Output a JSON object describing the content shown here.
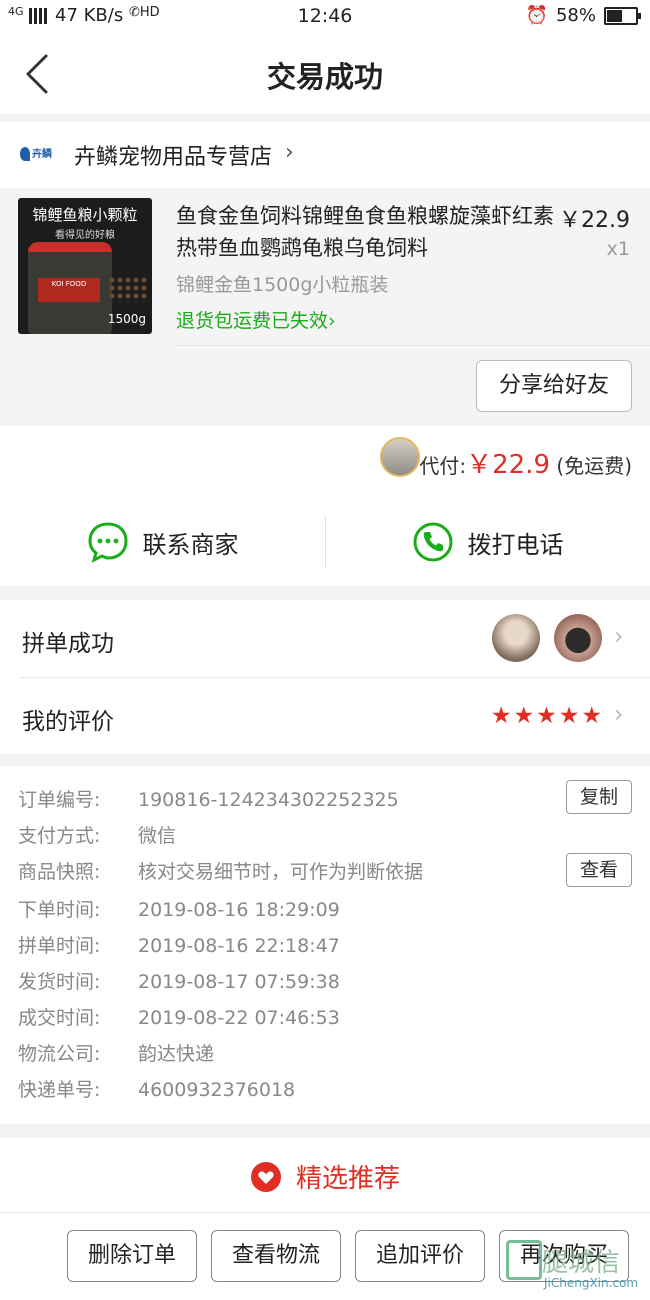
{
  "status": {
    "network": "4G",
    "speed": "47 KB/s",
    "hd": "HD",
    "time": "12:46",
    "battery": "58%",
    "battery_level": 0.58
  },
  "nav": {
    "title": "交易成功"
  },
  "store": {
    "logo_text": "卉鳞",
    "name": "卉鳞宠物用品专营店",
    "chevron": "›"
  },
  "product": {
    "thumb": {
      "banner": "锦鲤鱼粮小颗粒",
      "subtitle": "看得见的好粮",
      "brand": "KOI FOOD",
      "weight": "1500g"
    },
    "title": "鱼食金鱼饲料锦鲤鱼食鱼粮螺旋藻虾红素热带鱼血鹦鹉龟粮乌龟饲料",
    "price": "￥22.9",
    "quantity": "x1",
    "spec": "锦鲤金鱼1500g小粒瓶装",
    "return_note": "退货包运费已失效",
    "share_label": "分享给好友"
  },
  "payment": {
    "label": "代付:",
    "amount": "￥22.9",
    "note": "(免运费)"
  },
  "contact": {
    "merchant_label": "联系商家",
    "call_label": "拨打电话",
    "accent": "#1aad19"
  },
  "group": {
    "label": "拼单成功",
    "review_label": "我的评价",
    "stars": "★★★★★",
    "rating": 5
  },
  "details": {
    "rows": [
      {
        "label": "订单编号:",
        "value": "190816-124234302252325",
        "button": "复制"
      },
      {
        "label": "支付方式:",
        "value": "微信"
      },
      {
        "label": "商品快照:",
        "value": "核对交易细节时，可作为判断依据",
        "button": "查看"
      },
      {
        "label": "下单时间:",
        "value": "2019-08-16 18:29:09"
      },
      {
        "label": "拼单时间:",
        "value": "2019-08-16 22:18:47"
      },
      {
        "label": "发货时间:",
        "value": "2019-08-17 07:59:38"
      },
      {
        "label": "成交时间:",
        "value": "2019-08-22 07:46:53"
      },
      {
        "label": "物流公司:",
        "value": "韵达快递"
      },
      {
        "label": "快递单号:",
        "value": "4600932376018"
      }
    ]
  },
  "recommend": {
    "label": "精选推荐",
    "color": "#e02e24"
  },
  "actions": {
    "delete": "删除订单",
    "logistics": "查看物流",
    "add_review": "追加评价",
    "buy_again": "再次购买"
  },
  "watermark": {
    "text": "腿城信",
    "url_text": "JiChengXin.com"
  }
}
